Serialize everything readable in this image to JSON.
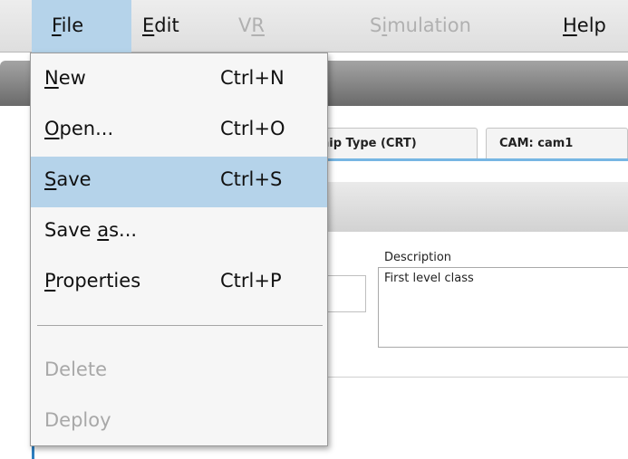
{
  "menubar": {
    "items": [
      {
        "label": "File",
        "mnemonic": "F",
        "rest": "ile",
        "state": "active"
      },
      {
        "label": "Edit",
        "mnemonic": "E",
        "rest": "dit",
        "state": "normal"
      },
      {
        "label": "VR",
        "pre": "V",
        "mnemonic": "R",
        "state": "disabled"
      },
      {
        "label": "Simulation",
        "pre": "S",
        "mnemonic": "i",
        "rest": "mulation",
        "state": "disabled"
      },
      {
        "label": "Help",
        "mnemonic": "H",
        "rest": "elp",
        "state": "normal"
      }
    ]
  },
  "file_menu": {
    "items": [
      {
        "label": "New",
        "mnemonic": "N",
        "rest": "ew",
        "shortcut": "Ctrl+N",
        "state": "normal"
      },
      {
        "label": "Open...",
        "mnemonic": "O",
        "rest": "pen...",
        "shortcut": "Ctrl+O",
        "state": "normal"
      },
      {
        "label": "Save",
        "mnemonic": "S",
        "rest": "ave",
        "shortcut": "Ctrl+S",
        "state": "selected"
      },
      {
        "label": "Save as...",
        "pre": "Save ",
        "mnemonic": "a",
        "rest": "s...",
        "shortcut": "",
        "state": "normal"
      },
      {
        "label": "Properties",
        "mnemonic": "P",
        "rest": "roperties",
        "shortcut": "Ctrl+P",
        "state": "normal"
      },
      {
        "label": "Delete",
        "shortcut": "",
        "state": "disabled"
      },
      {
        "label": "Deploy",
        "shortcut": "",
        "state": "disabled"
      }
    ]
  },
  "tabs": [
    {
      "label": "hip Type (CRT)"
    },
    {
      "label": "CAM: cam1"
    }
  ],
  "form": {
    "description_label": "Description",
    "description_value": "First level class"
  },
  "colors": {
    "highlight": "#b5d3ea",
    "tab_underline": "#77b6e3",
    "disabled_text": "#a8a8a8"
  }
}
